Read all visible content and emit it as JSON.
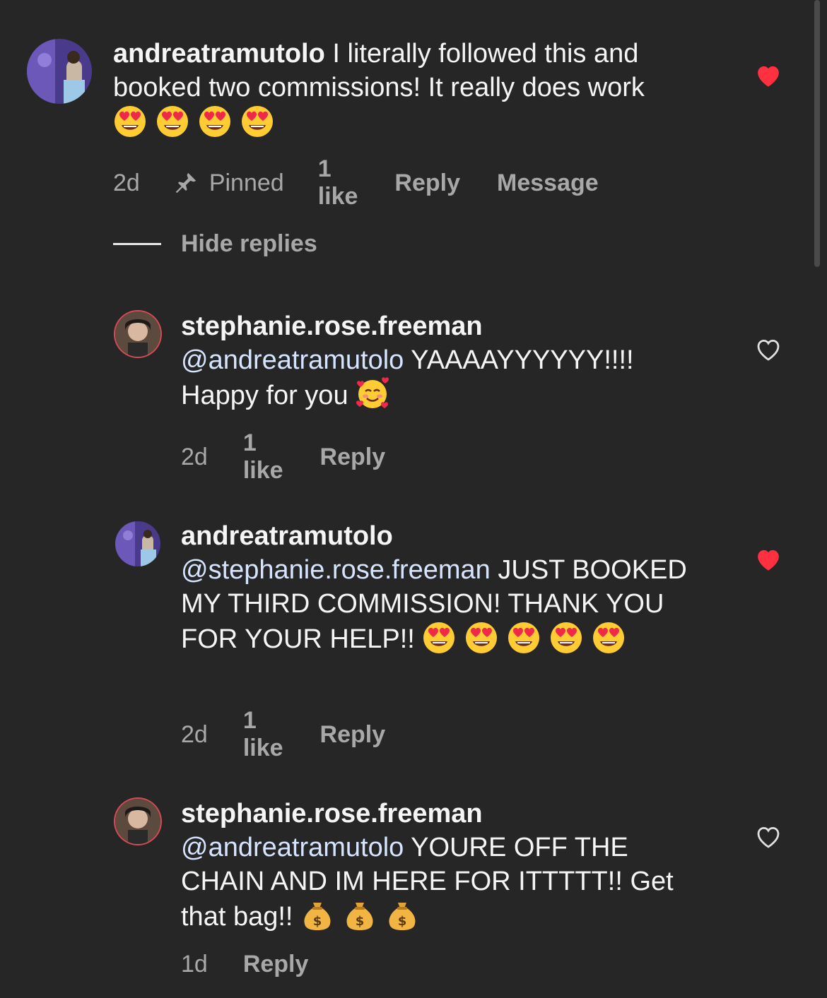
{
  "colors": {
    "background": "#262626",
    "text": "#f5f5f5",
    "muted": "#a8a8a8",
    "mention": "#d6e4ff",
    "liked_heart": "#ff3040"
  },
  "comments": [
    {
      "username": "andreatramutolo",
      "text": " I literally followed this and booked two commissions! It really does work ",
      "emojis": [
        "heart-eyes",
        "heart-eyes",
        "heart-eyes",
        "heart-eyes"
      ],
      "time": "2d",
      "pinned_label": "Pinned",
      "likes": "1 like",
      "reply": "Reply",
      "message": "Message",
      "liked": true
    }
  ],
  "hide_replies": "Hide replies",
  "replies": [
    {
      "username": "stephanie.rose.freeman",
      "mention": "@andreatramutolo",
      "text": " YAAAAYYYYYY!!!! Happy for you ",
      "emojis": [
        "smiling-hearts"
      ],
      "time": "2d",
      "likes": "1 like",
      "reply": "Reply",
      "liked": false
    },
    {
      "username": "andreatramutolo",
      "mention": "@stephanie.rose.freeman",
      "text": " JUST BOOKED MY THIRD COMMISSION! THANK YOU FOR YOUR HELP!! ",
      "emojis": [
        "heart-eyes",
        "heart-eyes",
        "heart-eyes",
        "heart-eyes",
        "heart-eyes"
      ],
      "time": "2d",
      "likes": "1 like",
      "reply": "Reply",
      "liked": true
    },
    {
      "username": "stephanie.rose.freeman",
      "mention": "@andreatramutolo",
      "text": " YOURE OFF THE CHAIN AND IM HERE FOR ITTTTT!! Get that bag!! ",
      "emojis": [
        "money-bag",
        "money-bag",
        "money-bag"
      ],
      "time": "1d",
      "reply": "Reply",
      "liked": false
    }
  ]
}
